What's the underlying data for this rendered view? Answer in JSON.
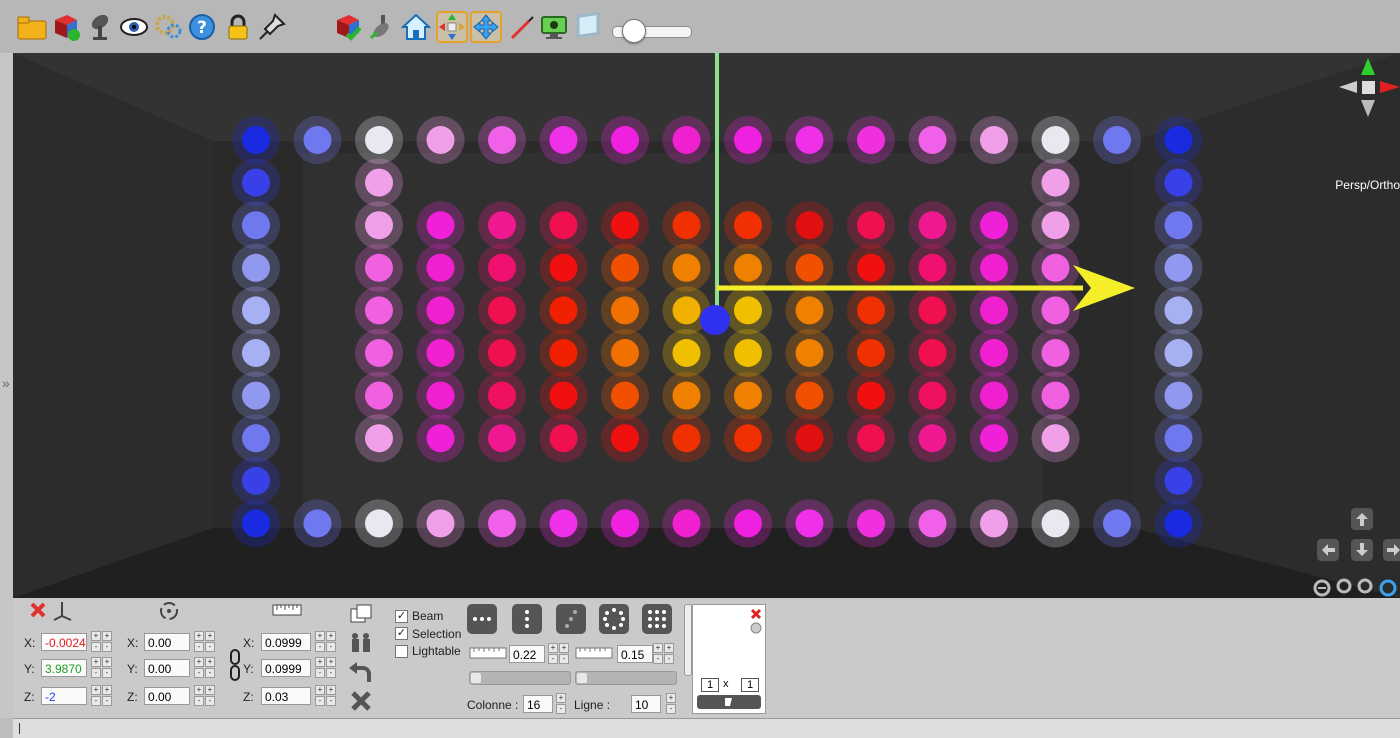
{
  "toolbar": {
    "icons": [
      "folder-icon",
      "add-fixture-icon",
      "spotlight-icon",
      "eye-icon",
      "settings-gear-icon",
      "help-icon",
      "lock-icon",
      "pin-icon",
      "check-fixture-icon",
      "pan-tilt-icon",
      "home-icon",
      "move-all-icon",
      "move-icon",
      "wand-icon",
      "screenshot-icon",
      "frame-icon"
    ],
    "highlighted": [
      "move-all-icon",
      "move-icon"
    ],
    "slider_value": 0.15
  },
  "viewport": {
    "view_mode_label": "Persp/Ortho",
    "grid": {
      "columns": 16,
      "rows": 10
    }
  },
  "bottom": {
    "position": {
      "x": "-0.0024",
      "y": "3.9870",
      "z": "-2"
    },
    "rotation": {
      "x": "0.00",
      "y": "0.00",
      "z": "0.00"
    },
    "scale": {
      "x": "0.0999",
      "y": "0.0999",
      "z": "0.03"
    },
    "axis_labels": {
      "x": "X:",
      "y": "Y:",
      "z": "Z:"
    },
    "checkboxes": [
      {
        "label": "Beam",
        "checked": true
      },
      {
        "label": "Selection",
        "checked": true
      },
      {
        "label": "Lightable",
        "checked": false
      }
    ],
    "spacing_h": "0.22",
    "spacing_v": "0.15",
    "colonne_label": "Colonne :",
    "colonne_value": "16",
    "ligne_label": "Ligne :",
    "ligne_value": "10",
    "preview_dims": {
      "w": "1",
      "x": "x",
      "h": "1"
    }
  }
}
